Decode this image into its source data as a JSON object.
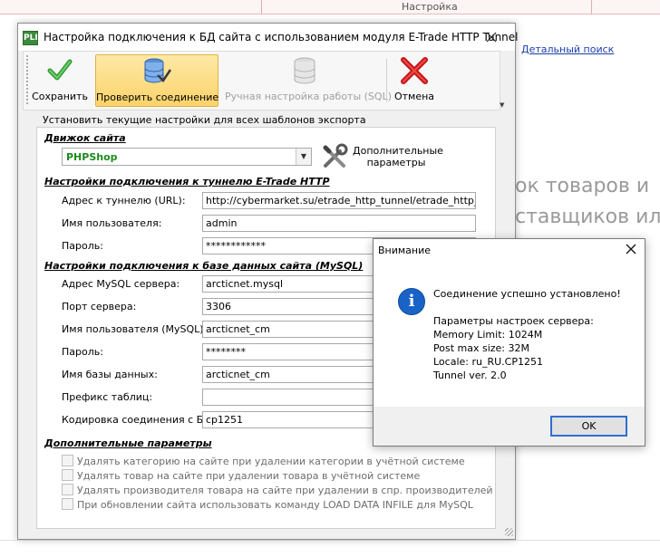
{
  "background": {
    "tab_label": "Настройка",
    "search_link": "Детальный поиск",
    "partial_line1": "ок товаров и",
    "partial_line2": "ставщиков ил"
  },
  "window": {
    "app_icon_text": "PLI",
    "title": "Настройка подключения к БД сайта с использованием модуля E-Trade HTTP Tunnel"
  },
  "toolbar": {
    "save_label": "Сохранить",
    "check_label": "Проверить соединение",
    "manual_sql_label": "Ручная настройка работы (SQL)",
    "cancel_label": "Отмена"
  },
  "form": {
    "apply_all_hint": "Установить текущие настройки для всех шаблонов экспорта",
    "engine_section": "Движок сайта",
    "engine_value": "PHPShop",
    "extra_params_button": "Дополнительные параметры",
    "tunnel_section": "Настройки подключения к туннелю E-Trade HTTP",
    "tunnel": {
      "url_label": "Адрес к туннелю (URL):",
      "url_value": "http://cybermarket.su/etrade_http_tunnel/etrade_http_tunn",
      "user_label": "Имя пользователя:",
      "user_value": "admin",
      "password_label": "Пароль:",
      "password_value": "************"
    },
    "mysql_section": "Настройки подключения к базе данных сайта (MySQL)",
    "mysql": {
      "host_label": "Адрес MySQL сервера:",
      "host_value": "arcticnet.mysql",
      "port_label": "Порт сервера:",
      "port_value": "3306",
      "user_label": "Имя пользователя (MySQL):",
      "user_value": "arcticnet_cm",
      "password_label": "Пароль:",
      "password_value": "********",
      "db_label": "Имя базы данных:",
      "db_value": "arcticnet_cm",
      "prefix_label": "Префикс таблиц:",
      "prefix_value": "",
      "encoding_label": "Кодировка соединения с БД:",
      "encoding_value": "cp1251"
    },
    "extra_section": "Дополнительные параметры",
    "extra_options": [
      "Удалять категорию на сайте при удалении категории в учётной системе",
      "Удалять товар на сайте при удалении товара в учётной системе",
      "Удалять производителя товара на сайте при удалении в спр. производителей",
      "При обновлении сайта использовать команду LOAD DATA INFILE для MySQL"
    ]
  },
  "message": {
    "title": "Внимание",
    "success": "Соединение успешно установлено!",
    "params_header": "Параметры настроек сервера:",
    "memory_limit": "Memory Limit: 1024M",
    "post_max": "Post max size: 32M",
    "locale": "Locale: ru_RU.CP1251",
    "tunnel_ver": "Tunnel ver. 2.0",
    "ok_label": "OK"
  },
  "icons": {
    "save": "check-mark-icon",
    "check": "database-check-icon",
    "manual_sql": "database-stack-icon",
    "cancel": "red-x-icon",
    "extra_params": "tools-icon",
    "info": "information-icon"
  },
  "colors": {
    "engine_value": "#1d8a1d",
    "active_button": "#fbd36a",
    "info_icon": "#1a63c6",
    "ok_border": "#2f6fd0"
  }
}
